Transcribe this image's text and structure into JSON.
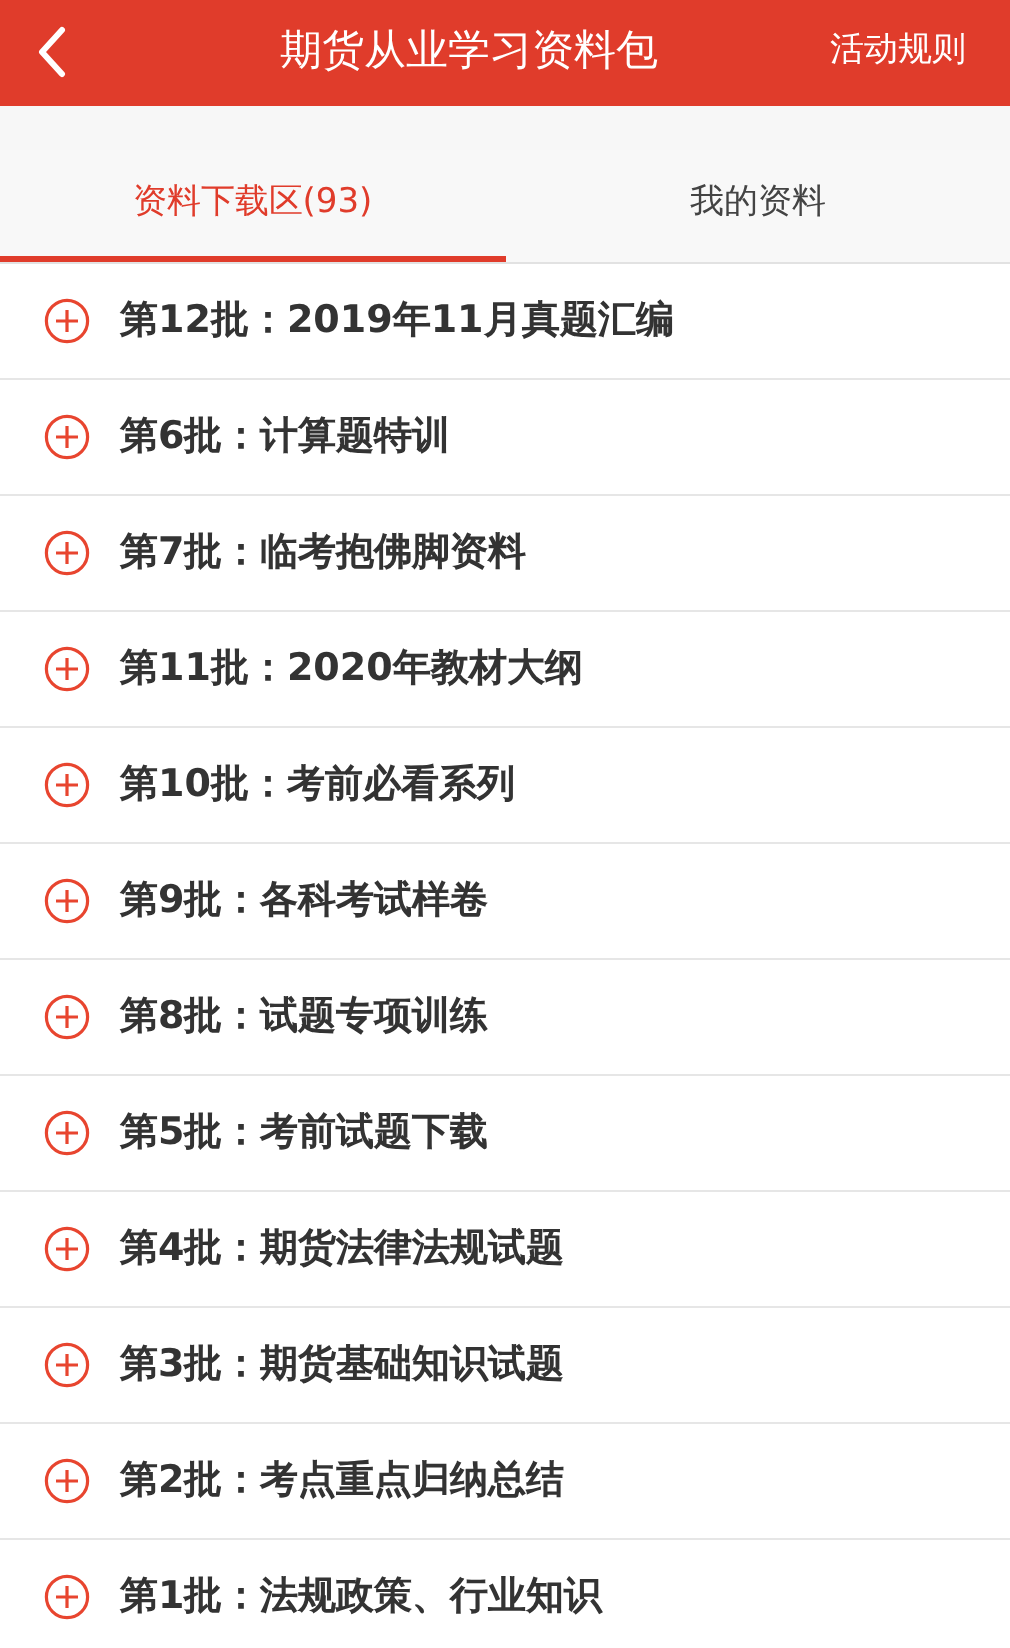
{
  "header": {
    "title": "期货从业学习资料包",
    "action": "活动规则"
  },
  "tabs": [
    {
      "label": "资料下载区(93)",
      "selected": true
    },
    {
      "label": "我的资料",
      "selected": false
    }
  ],
  "batches": [
    {
      "label": "第12批：2019年11月真题汇编",
      "expanded": false
    },
    {
      "label": "第6批：计算题特训",
      "expanded": false
    },
    {
      "label": "第7批：临考抱佛脚资料",
      "expanded": false
    },
    {
      "label": "第11批：2020年教材大纲",
      "expanded": false
    },
    {
      "label": "第10批：考前必看系列",
      "expanded": false
    },
    {
      "label": "第9批：各科考试样卷",
      "expanded": false
    },
    {
      "label": "第8批：试题专项训练",
      "expanded": false
    },
    {
      "label": "第5批：考前试题下载",
      "expanded": false
    },
    {
      "label": "第4批：期货法律法规试题",
      "expanded": false
    },
    {
      "label": "第3批：期货基础知识试题",
      "expanded": false
    },
    {
      "label": "第2批：考点重点归纳总结",
      "expanded": false
    },
    {
      "label": "第1批：法规政策、行业知识",
      "expanded": false
    }
  ]
}
